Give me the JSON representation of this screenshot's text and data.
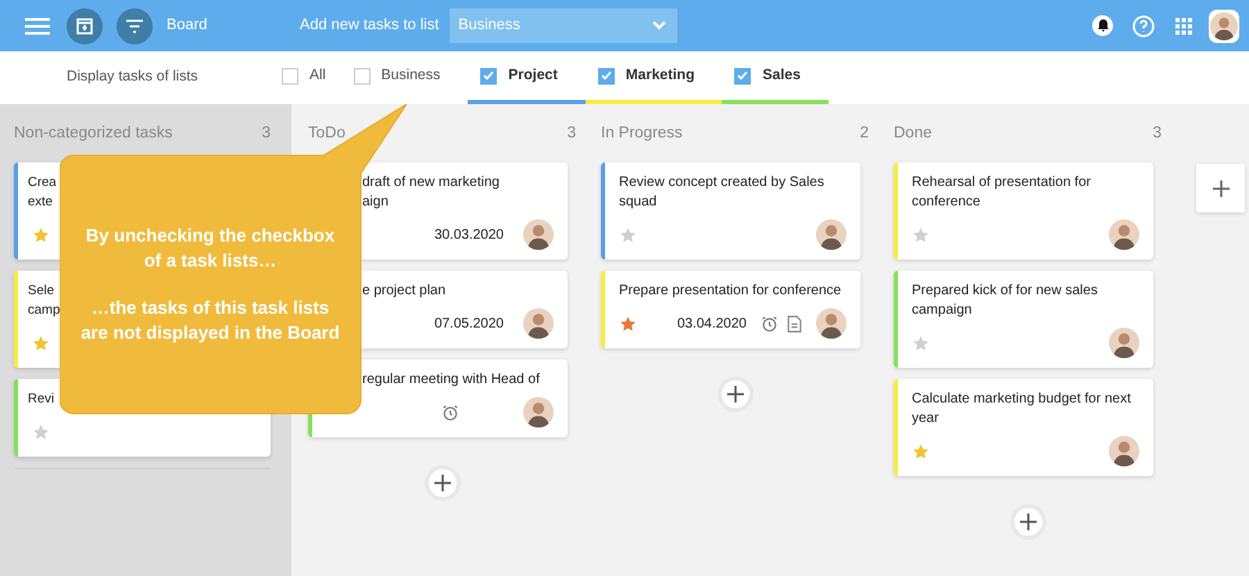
{
  "header": {
    "title": "Board",
    "add_label": "Add new tasks to list",
    "list_select": {
      "value": "Business"
    }
  },
  "filter": {
    "label": "Display tasks of lists",
    "lists": [
      {
        "label": "All",
        "checked": false
      },
      {
        "label": "Business",
        "checked": false
      },
      {
        "label": "Project",
        "checked": true,
        "color": "#5b9ee8"
      },
      {
        "label": "Marketing",
        "checked": true,
        "color": "#f5ee3f"
      },
      {
        "label": "Sales",
        "checked": true,
        "color": "#86e05a"
      }
    ]
  },
  "columns": [
    {
      "title": "Non-categorized tasks",
      "count": "3",
      "cards": [
        {
          "title_lines": [
            "Crea",
            "exte"
          ],
          "color": "#5b9ee8",
          "starred": true,
          "high_priority": false
        },
        {
          "title_lines": [
            "Sele",
            "camp"
          ],
          "color": "#f5ee3f",
          "starred": true,
          "high_priority": false
        },
        {
          "title_lines": [
            "Revi"
          ],
          "color": "#86e05a",
          "starred": false
        }
      ]
    },
    {
      "title": "ToDo",
      "count": "3",
      "cards": [
        {
          "title_lines": [
            "draft of new marketing",
            "aign"
          ],
          "date": "30.03.2020",
          "avatar": true
        },
        {
          "title_lines": [
            "e project plan"
          ],
          "date": "07.05.2020",
          "avatar": true
        },
        {
          "title_lines": [
            "regular meeting with Head of"
          ],
          "color": "#86e05a",
          "alarm": true,
          "avatar": true
        }
      ]
    },
    {
      "title": "In Progress",
      "count": "2",
      "cards": [
        {
          "title_lines": [
            "Review concept created by Sales",
            "squad"
          ],
          "color": "#5b9ee8",
          "starred": false,
          "avatar": true
        },
        {
          "title_lines": [
            "Prepare presentation for conference"
          ],
          "color": "#f5ee3f",
          "starred": true,
          "high_priority": true,
          "date": "03.04.2020",
          "alarm": true,
          "note": true,
          "avatar": true
        }
      ]
    },
    {
      "title": "Done",
      "count": "3",
      "cards": [
        {
          "title_lines": [
            "Rehearsal of presentation for",
            "conference"
          ],
          "color": "#f5ee3f",
          "starred": false,
          "avatar": true
        },
        {
          "title_lines": [
            "Prepared kick of for new sales",
            "campaign"
          ],
          "color": "#86e05a",
          "starred": false,
          "avatar": true
        },
        {
          "title_lines": [
            "Calculate marketing budget for next",
            "year"
          ],
          "color": "#f5ee3f",
          "starred": true,
          "high_priority": false,
          "avatar": true
        }
      ]
    }
  ],
  "callout": {
    "paragraphs": [
      "By unchecking the checkbox of a task lists…",
      "…the tasks of this task lists are not displayed in the Board"
    ]
  }
}
